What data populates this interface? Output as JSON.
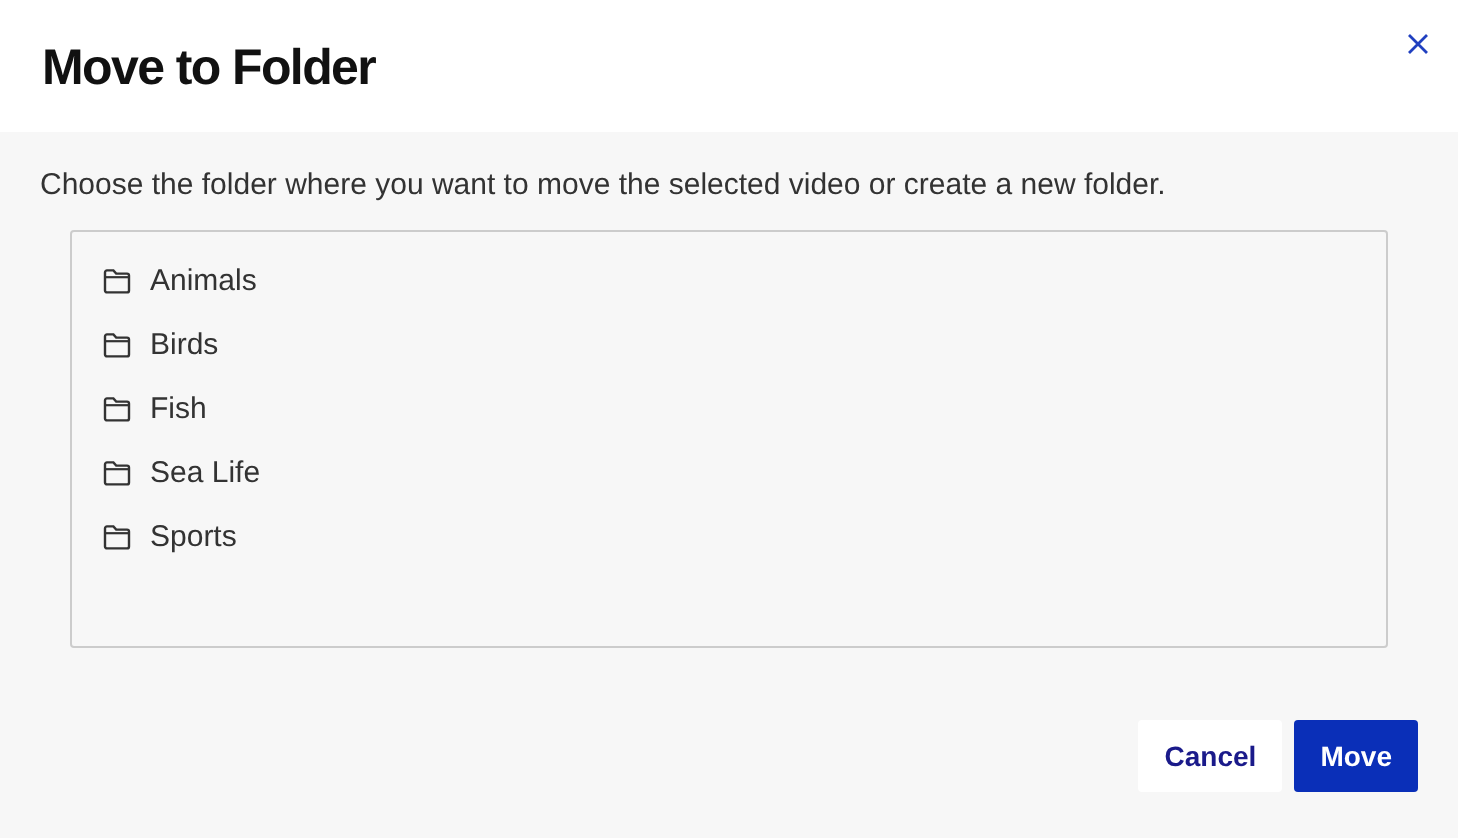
{
  "dialog": {
    "title": "Move to Folder",
    "description": "Choose the folder where you want to move the selected video or create a new folder.",
    "folders": [
      {
        "name": "Animals"
      },
      {
        "name": "Birds"
      },
      {
        "name": "Fish"
      },
      {
        "name": "Sea Life"
      },
      {
        "name": "Sports"
      }
    ],
    "buttons": [
      {
        "label": "Cancel",
        "kind": "secondary"
      },
      {
        "label": "Move",
        "kind": "primary"
      }
    ]
  }
}
